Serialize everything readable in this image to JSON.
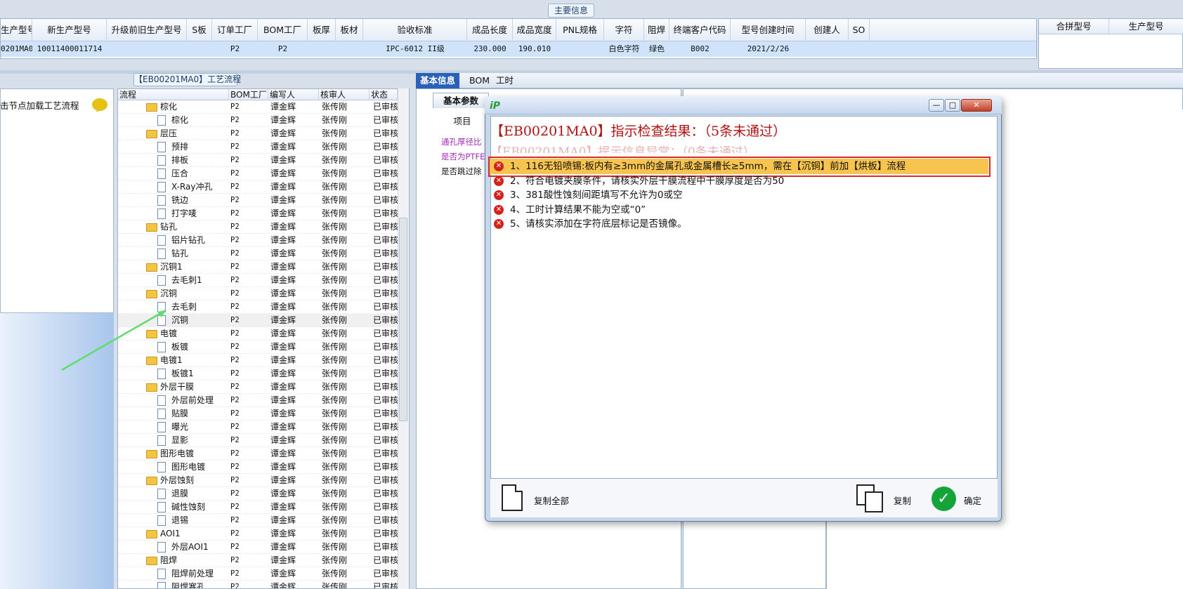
{
  "main_info": {
    "title": "主要信息",
    "headers": [
      "生产型号",
      "新生产型号",
      "升级前旧生产型号",
      "S板",
      "订单工厂",
      "BOM工厂",
      "板厚",
      "板材",
      "验收标准",
      "成品长度",
      "成品宽度",
      "PNL规格",
      "字符",
      "阻焊",
      "终端客户代码",
      "型号创建时间",
      "创建人",
      "SO"
    ],
    "row": [
      "0201MA0",
      "10011400011714",
      "",
      "",
      "P2",
      "P2",
      "",
      "",
      "IPC-6012 II级",
      "230.000",
      "190.010",
      "",
      "白色字符",
      "绿色",
      "B002",
      "2021/2/26",
      "",
      ""
    ]
  },
  "merge_info": {
    "headers": [
      "合拼型号",
      "生产型号"
    ]
  },
  "left_panel": {
    "tip": "击节点加载工艺流程"
  },
  "process": {
    "title": "【EB00201MA0】工艺流程",
    "columns": [
      "流程",
      "BOM工厂",
      "编写人",
      "核审人",
      "状态"
    ],
    "rows": [
      {
        "level": 0,
        "type": "folder",
        "name": "棕化",
        "bom": "P2",
        "writer": "谭金辉",
        "reviewer": "张传刚",
        "status": "已审核"
      },
      {
        "level": 1,
        "type": "doc",
        "name": "棕化",
        "bom": "P2",
        "writer": "谭金辉",
        "reviewer": "张传刚",
        "status": "已审核"
      },
      {
        "level": 0,
        "type": "folder",
        "name": "层压",
        "bom": "P2",
        "writer": "谭金辉",
        "reviewer": "张传刚",
        "status": "已审核"
      },
      {
        "level": 1,
        "type": "doc",
        "name": "预排",
        "bom": "P2",
        "writer": "谭金辉",
        "reviewer": "张传刚",
        "status": "已审核"
      },
      {
        "level": 1,
        "type": "doc",
        "name": "排板",
        "bom": "P2",
        "writer": "谭金辉",
        "reviewer": "张传刚",
        "status": "已审核"
      },
      {
        "level": 1,
        "type": "doc",
        "name": "压合",
        "bom": "P2",
        "writer": "谭金辉",
        "reviewer": "张传刚",
        "status": "已审核"
      },
      {
        "level": 1,
        "type": "doc",
        "name": "X-Ray冲孔",
        "bom": "P2",
        "writer": "谭金辉",
        "reviewer": "张传刚",
        "status": "已审核"
      },
      {
        "level": 1,
        "type": "doc",
        "name": "铣边",
        "bom": "P2",
        "writer": "谭金辉",
        "reviewer": "张传刚",
        "status": "已审核"
      },
      {
        "level": 1,
        "type": "doc",
        "name": "打字唛",
        "bom": "P2",
        "writer": "谭金辉",
        "reviewer": "张传刚",
        "status": "已审核"
      },
      {
        "level": 0,
        "type": "folder",
        "name": "钻孔",
        "bom": "P2",
        "writer": "谭金辉",
        "reviewer": "张传刚",
        "status": "已审核"
      },
      {
        "level": 1,
        "type": "doc",
        "name": "铝片钻孔",
        "bom": "P2",
        "writer": "谭金辉",
        "reviewer": "张传刚",
        "status": "已审核"
      },
      {
        "level": 1,
        "type": "doc",
        "name": "钻孔",
        "bom": "P2",
        "writer": "谭金辉",
        "reviewer": "张传刚",
        "status": "已审核"
      },
      {
        "level": 0,
        "type": "folder",
        "name": "沉铜1",
        "bom": "P2",
        "writer": "谭金辉",
        "reviewer": "张传刚",
        "status": "已审核"
      },
      {
        "level": 1,
        "type": "doc",
        "name": "去毛刺1",
        "bom": "P2",
        "writer": "谭金辉",
        "reviewer": "张传刚",
        "status": "已审核"
      },
      {
        "level": 0,
        "type": "folder",
        "name": "沉铜",
        "bom": "P2",
        "writer": "谭金辉",
        "reviewer": "张传刚",
        "status": "已审核"
      },
      {
        "level": 1,
        "type": "doc",
        "name": "去毛刺",
        "bom": "P2",
        "writer": "谭金辉",
        "reviewer": "张传刚",
        "status": "已审核"
      },
      {
        "level": 1,
        "type": "doc",
        "name": "沉铜",
        "bom": "P2",
        "writer": "谭金辉",
        "reviewer": "张传刚",
        "status": "已审核",
        "selected": true
      },
      {
        "level": 0,
        "type": "folder",
        "name": "电镀",
        "bom": "P2",
        "writer": "谭金辉",
        "reviewer": "张传刚",
        "status": "已审核"
      },
      {
        "level": 1,
        "type": "doc",
        "name": "板镀",
        "bom": "P2",
        "writer": "谭金辉",
        "reviewer": "张传刚",
        "status": "已审核"
      },
      {
        "level": 0,
        "type": "folder",
        "name": "电镀1",
        "bom": "P2",
        "writer": "谭金辉",
        "reviewer": "张传刚",
        "status": "已审核"
      },
      {
        "level": 1,
        "type": "doc",
        "name": "板镀1",
        "bom": "P2",
        "writer": "谭金辉",
        "reviewer": "张传刚",
        "status": "已审核"
      },
      {
        "level": 0,
        "type": "folder",
        "name": "外层干膜",
        "bom": "P2",
        "writer": "谭金辉",
        "reviewer": "张传刚",
        "status": "已审核"
      },
      {
        "level": 1,
        "type": "doc",
        "name": "外层前处理",
        "bom": "P2",
        "writer": "谭金辉",
        "reviewer": "张传刚",
        "status": "已审核"
      },
      {
        "level": 1,
        "type": "doc",
        "name": "贴膜",
        "bom": "P2",
        "writer": "谭金辉",
        "reviewer": "张传刚",
        "status": "已审核"
      },
      {
        "level": 1,
        "type": "doc",
        "name": "曝光",
        "bom": "P2",
        "writer": "谭金辉",
        "reviewer": "张传刚",
        "status": "已审核"
      },
      {
        "level": 1,
        "type": "doc",
        "name": "显影",
        "bom": "P2",
        "writer": "谭金辉",
        "reviewer": "张传刚",
        "status": "已审核"
      },
      {
        "level": 0,
        "type": "folder",
        "name": "图形电镀",
        "bom": "P2",
        "writer": "谭金辉",
        "reviewer": "张传刚",
        "status": "已审核"
      },
      {
        "level": 1,
        "type": "doc",
        "name": "图形电镀",
        "bom": "P2",
        "writer": "谭金辉",
        "reviewer": "张传刚",
        "status": "已审核"
      },
      {
        "level": 0,
        "type": "folder",
        "name": "外层蚀刻",
        "bom": "P2",
        "writer": "谭金辉",
        "reviewer": "张传刚",
        "status": "已审核"
      },
      {
        "level": 1,
        "type": "doc",
        "name": "退膜",
        "bom": "P2",
        "writer": "谭金辉",
        "reviewer": "张传刚",
        "status": "已审核"
      },
      {
        "level": 1,
        "type": "doc",
        "name": "碱性蚀刻",
        "bom": "P2",
        "writer": "谭金辉",
        "reviewer": "张传刚",
        "status": "已审核"
      },
      {
        "level": 1,
        "type": "doc",
        "name": "退锡",
        "bom": "P2",
        "writer": "谭金辉",
        "reviewer": "张传刚",
        "status": "已审核"
      },
      {
        "level": 0,
        "type": "folder",
        "name": "AOI1",
        "bom": "P2",
        "writer": "谭金辉",
        "reviewer": "张传刚",
        "status": "已审核"
      },
      {
        "level": 1,
        "type": "doc",
        "name": "外层AOI1",
        "bom": "P2",
        "writer": "谭金辉",
        "reviewer": "张传刚",
        "status": "已审核"
      },
      {
        "level": 0,
        "type": "folder",
        "name": "阻焊",
        "bom": "P2",
        "writer": "谭金辉",
        "reviewer": "张传刚",
        "status": "已审核"
      },
      {
        "level": 1,
        "type": "doc",
        "name": "阻焊前处理",
        "bom": "P2",
        "writer": "谭金辉",
        "reviewer": "张传刚",
        "status": "已审核"
      },
      {
        "level": 1,
        "type": "doc",
        "name": "阻焊塞孔",
        "bom": "P2",
        "writer": "谭金辉",
        "reviewer": "张传刚",
        "status": "已审核"
      }
    ]
  },
  "mid_panel": {
    "tabs": [
      "基本信息",
      "BOM",
      "工时"
    ],
    "sub_tab": "基本参数",
    "grid_header": "项目",
    "rows": [
      "通孔厚径比",
      "是否为PTFE",
      "是否跳过除"
    ]
  },
  "dialog": {
    "heading": "【EB00201MA0】指示检查结果：（5条未通过）",
    "ghost_heading": "【EB00201MA0】提示信息异常：（0条未通过）",
    "items": [
      "1、116无铅喷锡:板内有≥3mm的金属孔或金属槽长≥5mm，需在【沉铜】前加【烘板】流程",
      "2、符合电镀夹膜条件，请核实外层干膜流程中干膜厚度是否为50",
      "3、381酸性蚀刻间距填写不允许为0或空",
      "4、工时计算结果不能为空或“0”",
      "5、请核实添加在字符底层标记是否镜像。"
    ],
    "copy_all_label": "复制全部",
    "copy_label": "复制",
    "ok_label": "确定",
    "colors": {
      "error": "#d5221b",
      "highlight": "#f6c44f",
      "heading": "#b01010"
    }
  }
}
